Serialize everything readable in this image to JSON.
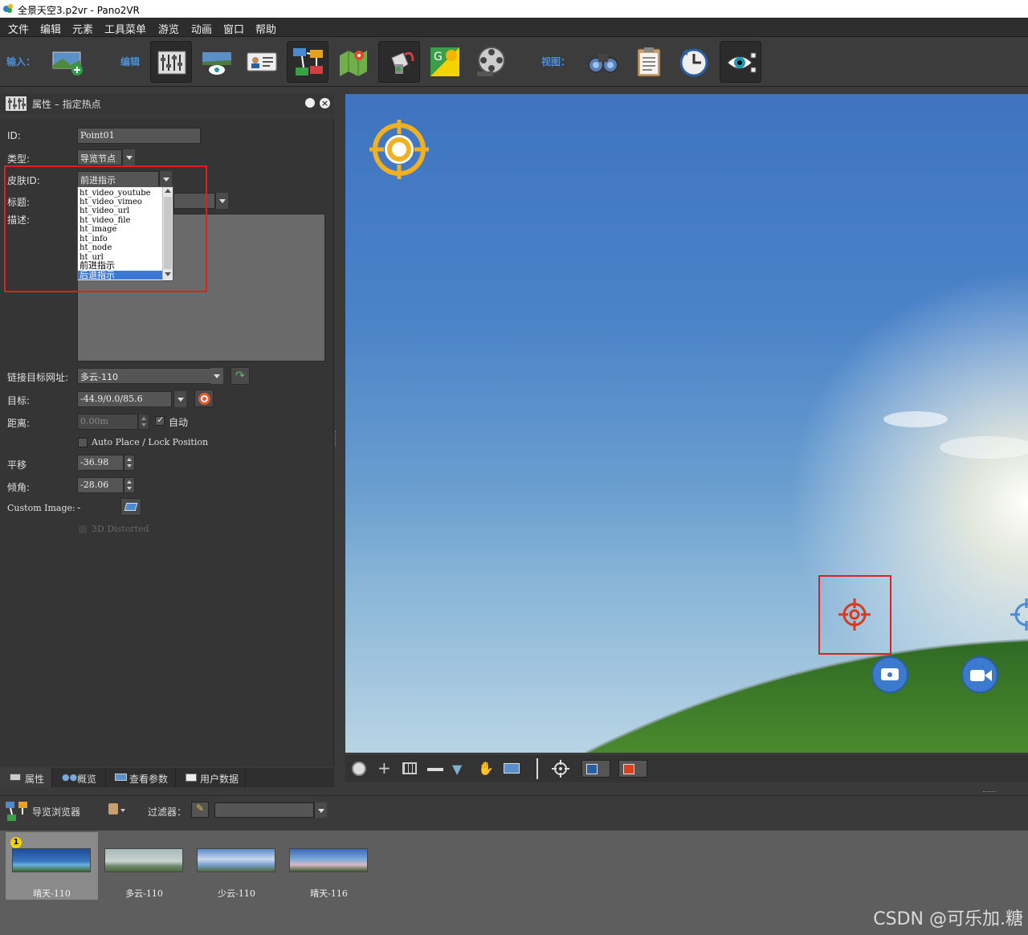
{
  "window": {
    "title": "全景天空3.p2vr - Pano2VR"
  },
  "menu": [
    "文件",
    "编辑",
    "元素",
    "工具菜单",
    "游览",
    "动画",
    "窗口",
    "帮助"
  ],
  "toolbar": {
    "input_label": "输入：",
    "edit_label": "编辑",
    "view_label": "视图："
  },
  "properties": {
    "header_title": "属性 – 指定热点",
    "id_label": "ID:",
    "id_value": "Point01",
    "type_label": "类型:",
    "type_value": "导览节点",
    "skin_label": "皮肤ID:",
    "skin_value": "前进指示",
    "title_label": "标题:",
    "desc_label": "描述:",
    "link_label": "链接目标网址:",
    "link_value": "多云-110",
    "target_label": "目标:",
    "target_value": "-44.9/0.0/85.6",
    "distance_label": "距离:",
    "distance_value": "0.00m",
    "auto_label": "自动",
    "auto_checked": true,
    "autoplace_label": "Auto Place / Lock Position",
    "pan_label": "平移",
    "pan_value": "-36.98",
    "tilt_label": "倾角:",
    "tilt_value": "-28.06",
    "custom_image_label": "Custom Image:",
    "custom_image_value": "-",
    "distorted_label": "3D Distorted"
  },
  "skin_options": [
    "ht_video_youtube",
    "ht_video_vimeo",
    "ht_video_url",
    "ht_video_file",
    "ht_image",
    "ht_info",
    "ht_node",
    "ht_url",
    "前进指示",
    "后退指示"
  ],
  "skin_selected_option": "后退指示",
  "tabs": [
    "属性",
    "概览",
    "查看参数",
    "用户数据"
  ],
  "browser": {
    "title": "导览浏览器",
    "filter_label": "过滤器：",
    "badge": "1",
    "items": [
      {
        "caption": "晴天-110"
      },
      {
        "caption": "多云-110"
      },
      {
        "caption": "少云-110"
      },
      {
        "caption": "晴天-116"
      }
    ]
  },
  "watermark": "CSDN @可乐加.糖"
}
